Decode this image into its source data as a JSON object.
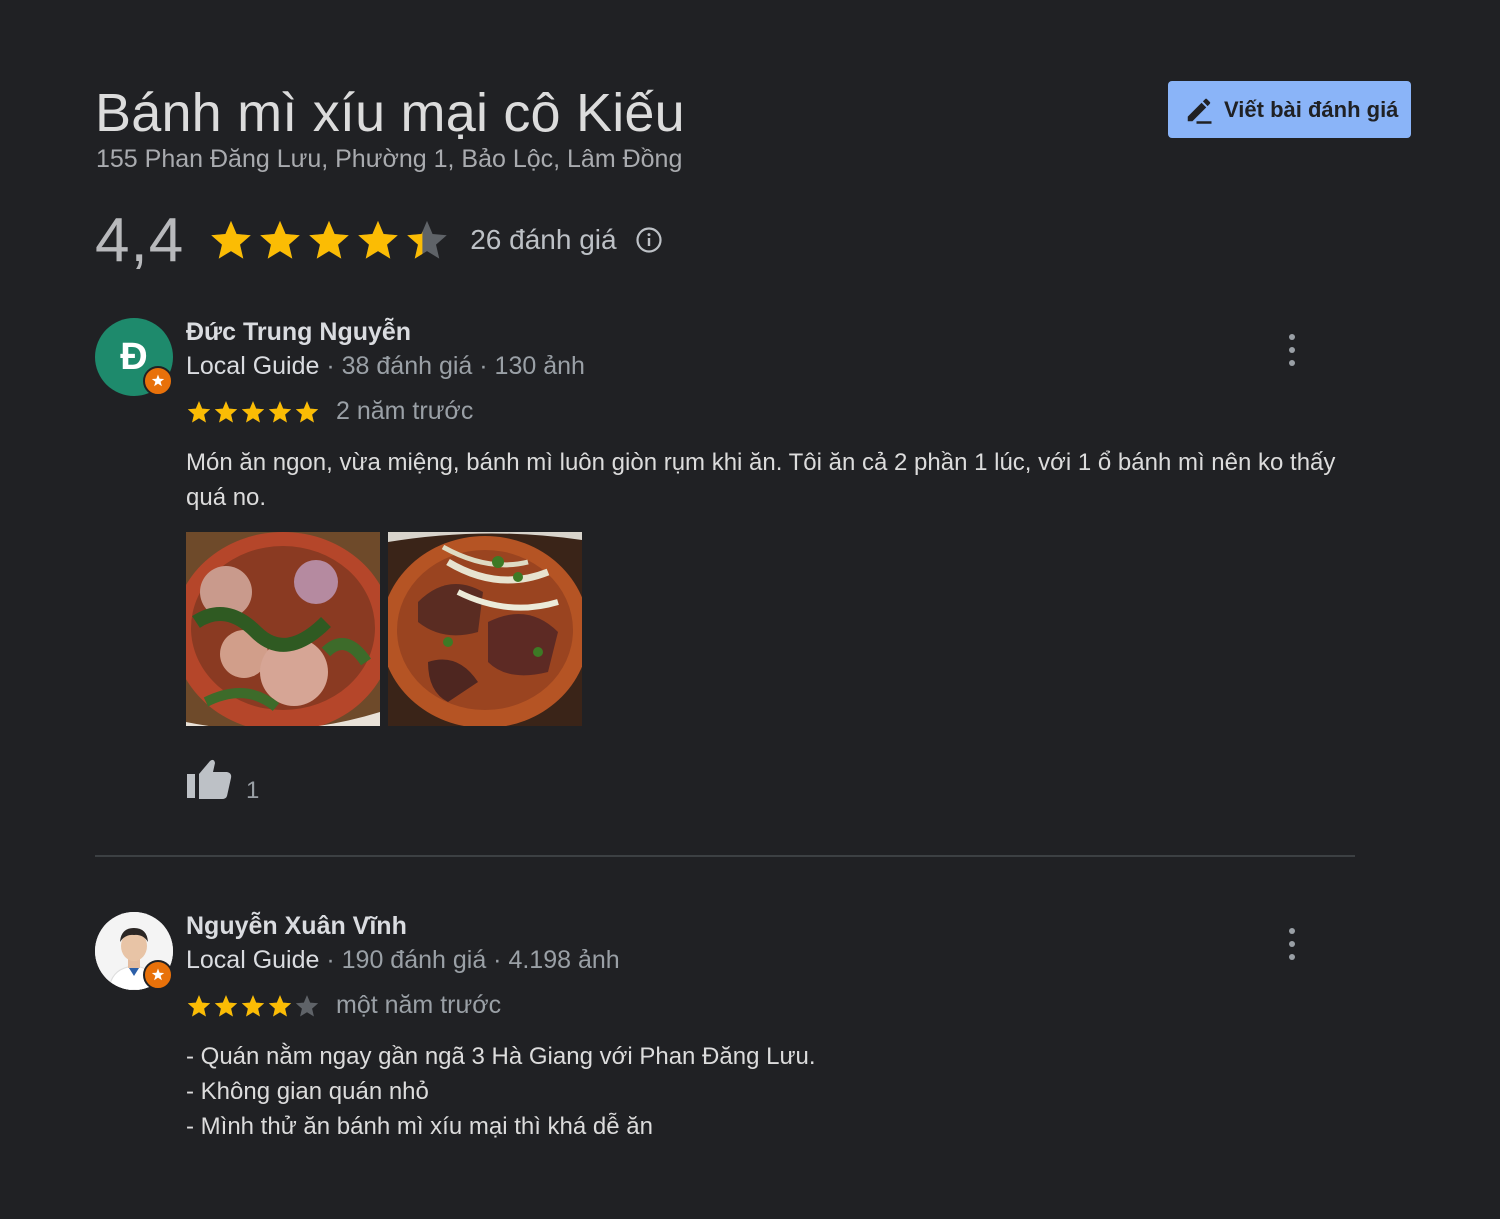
{
  "place": {
    "name": "Bánh mì xíu mại cô Kiếu",
    "address": "155 Phan Đăng Lưu, Phường 1, Bảo Lộc, Lâm Đồng",
    "rating": "4,4",
    "stars_value": 4.4,
    "review_count": "26 đánh giá"
  },
  "actions": {
    "write_review": "Viết bài đánh giá"
  },
  "colors": {
    "star": "#fbbc04",
    "star_empty": "#5f6368",
    "accent": "#8ab4f8",
    "guide_badge": "#e8710a"
  },
  "reviews": [
    {
      "avatar_letter": "Đ",
      "name": "Đức Trung Nguyễn",
      "level": "Local Guide",
      "stats": " · 38 đánh giá · 130 ảnh",
      "stars": 5,
      "time": "2 năm trước",
      "text": "Món ăn ngon, vừa miệng, bánh mì luôn giòn rụm khi ăn. Tôi ăn cả 2 phần 1 lúc, với 1 ổ bánh mì nên ko thấy quá no.",
      "likes": "1"
    },
    {
      "name": "Nguyễn Xuân Vĩnh",
      "level": "Local Guide",
      "stats": " · 190 đánh giá · 4.198 ảnh",
      "stars": 4,
      "time": "một năm trước",
      "text_lines": [
        "- Quán nằm ngay gần ngã 3 Hà Giang với Phan Đăng Lưu.",
        "- Không gian quán nhỏ",
        "- Mình thử ăn bánh mì xíu mại thì khá dễ ăn"
      ]
    }
  ]
}
